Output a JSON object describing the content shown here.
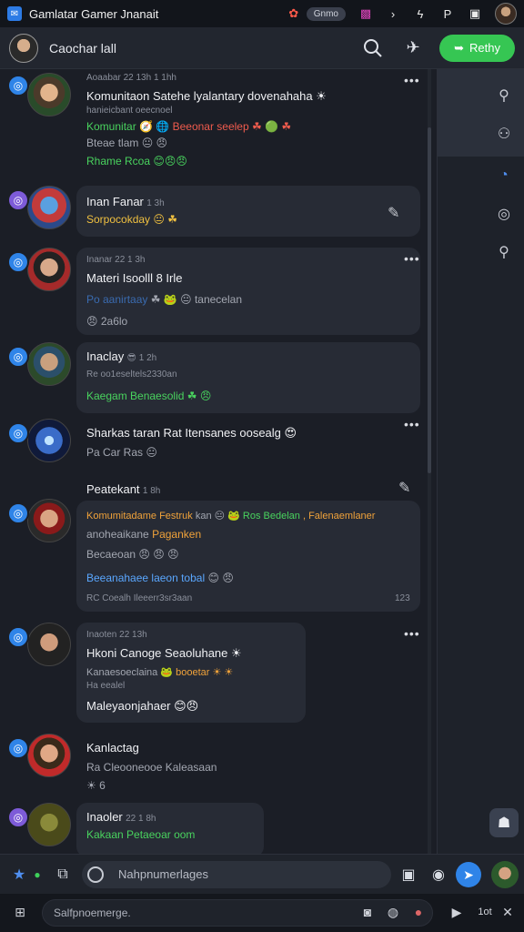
{
  "app": {
    "title": "Gamlatar Gamer Jnanait",
    "status_pill": "Gnmo"
  },
  "header": {
    "title": "Caochar lall",
    "reply_label": "Rethy"
  },
  "posts": [
    {
      "meta": "Aoaabar 22 13h 1 1hh",
      "title": "Komunitaon Satehe lyalantary dovenahaha ☀",
      "sub": "hanieicbant oeecnoel",
      "l3a": "Komunitar 🧭 🌐",
      "l3b": "Beeonar seelep ☘ 🟢 ☘",
      "l4": "Bteae tlam 😐 😠",
      "l5": "Rhame Rcoa 😊😠😠"
    },
    {
      "meta_name": "Inan Fanar",
      "meta_time": "1 3h",
      "l1": "Sorpocokday 😐 ☘"
    },
    {
      "meta": "Inanar 22 1 3h",
      "title": "Materi Isoolll 8 Irle",
      "l2a": "Po aanirtaay",
      "l2b": "☘ 🐸 😐 tanecelan",
      "l3": "😠 2a6lo"
    },
    {
      "meta_name": "Inaclay",
      "meta_time": "😎 1 2h",
      "l1": "Re oo1eseltels2330an",
      "l2": "Kaegam Benaesolid ☘ 😠"
    },
    {
      "title": "Sharkas taran Rat Itensanes oosealg 😍",
      "l1": "Pa Car Ras 😐",
      "meta_name": "Peatekant",
      "meta_time": "1 8h"
    },
    {
      "l1a": "Komumitadame Festruk",
      "l1b": "kan 😐 🐸",
      "l1c": "Ros Bedelan",
      "l1d": ", Falenaemlaner",
      "l2a": "anoheaikane",
      "l2b": "Paganken",
      "l3": "Becaeoan 😠 😠 😠",
      "l4a": "Beeanahaee laeon tobal",
      "l4b": "😊 😠",
      "l5": "RC Coealh Ileeerr3sr3aan",
      "count": "123"
    },
    {
      "meta": "Inaoten 22 13h",
      "title": "Hkoni Canoge Seaoluhane ☀",
      "l2a": "Kanaesoeclaina 🐸",
      "l2b": "booetar ☀ ☀",
      "l3": "Ha eealel",
      "l4": "Maleyaonjahaer 😊😠"
    },
    {
      "title": "Kanlactag",
      "l1": "Ra Cleooneooe Kaleasaan",
      "l2": "☀ 6"
    },
    {
      "meta_name": "Inaoler",
      "meta_time": "22 1 8h",
      "l1": "Kakaan Petaeoar oom"
    }
  ],
  "composer": {
    "placeholder": "Nahpnumerlages"
  },
  "bottombar": {
    "placeholder": "Salfpnoemerge.",
    "label": "1ot"
  }
}
